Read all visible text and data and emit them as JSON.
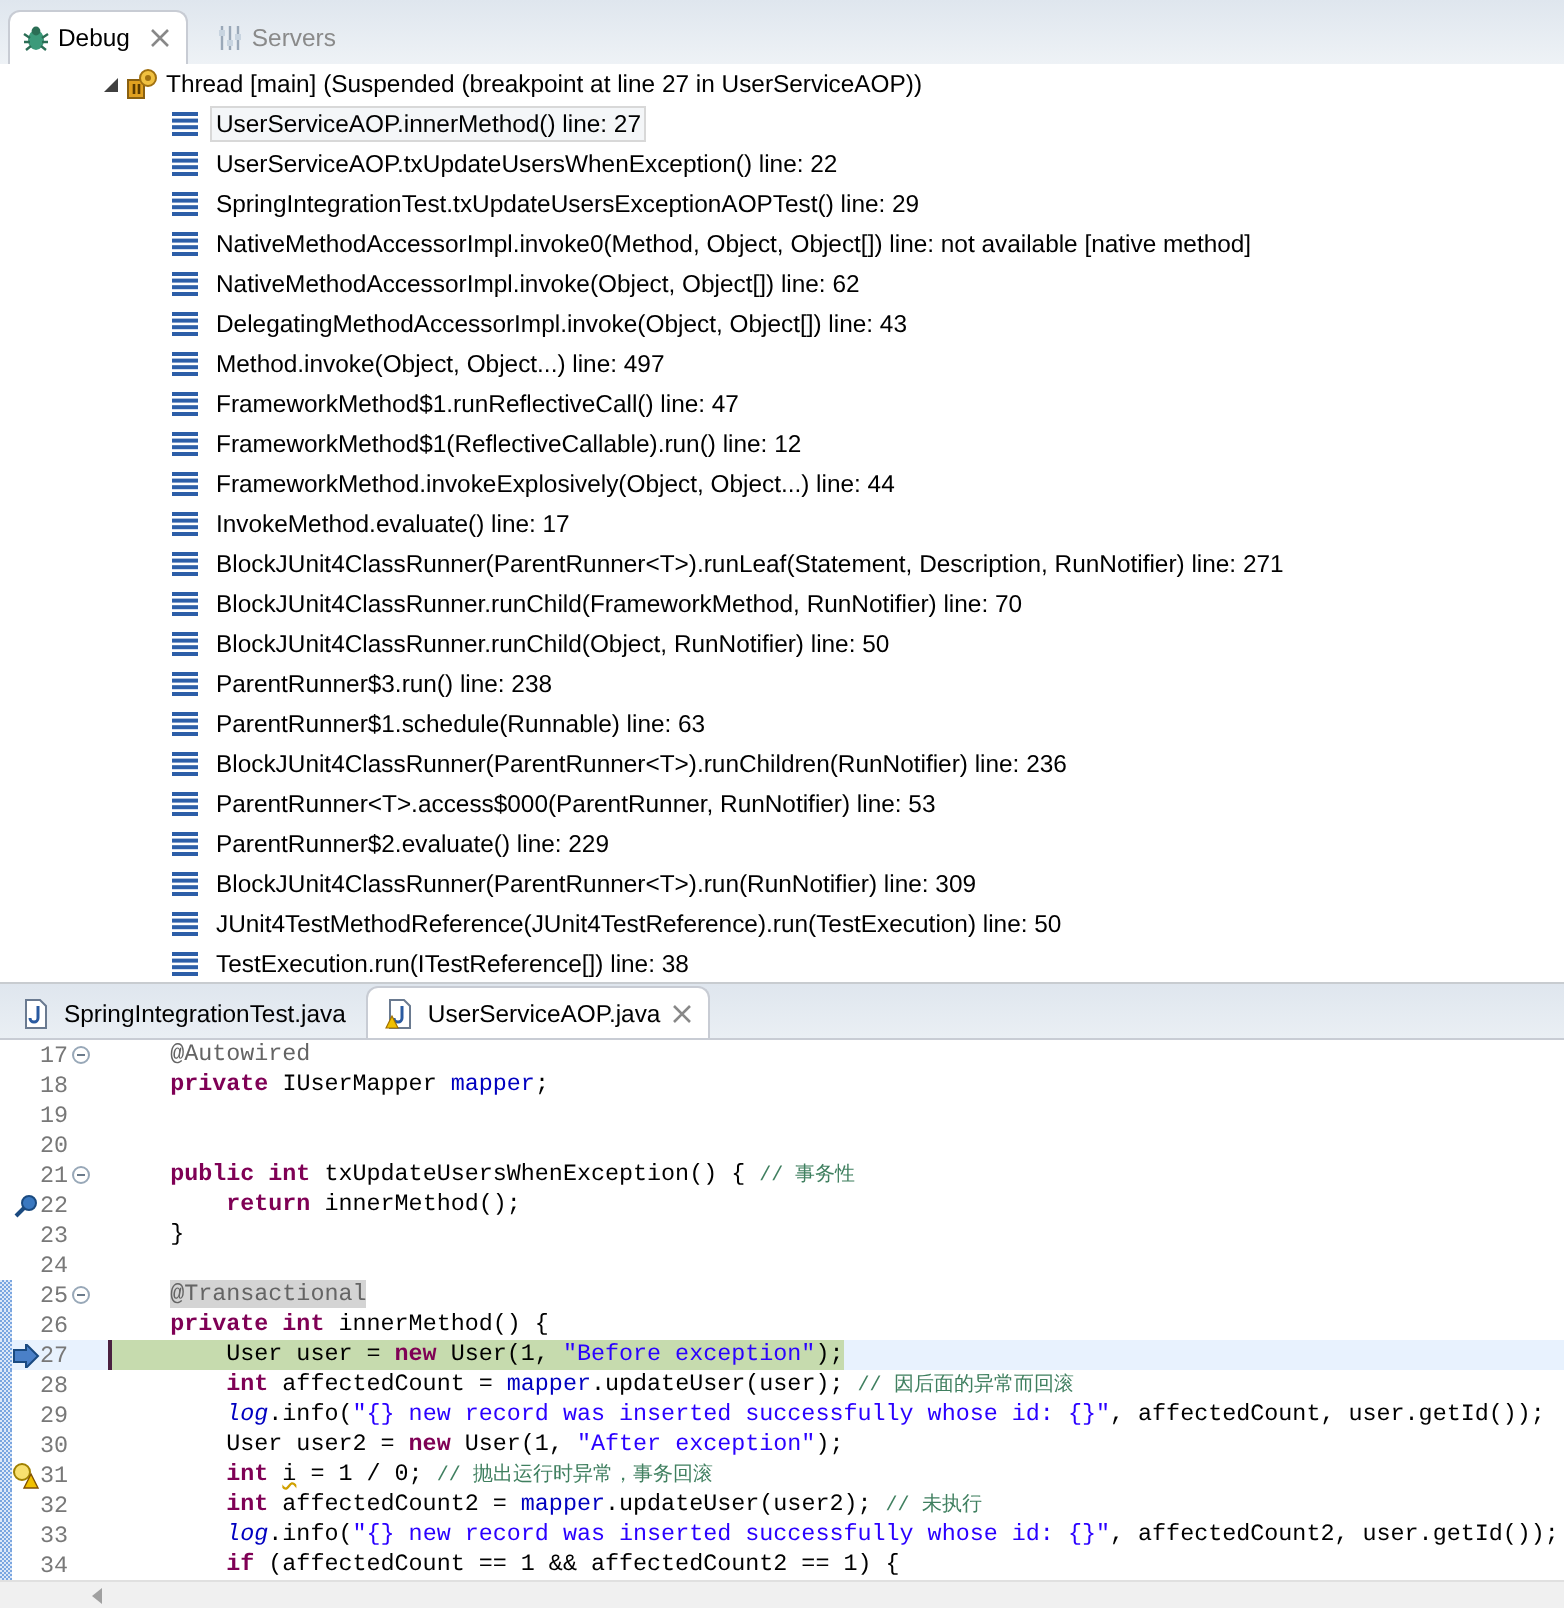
{
  "debug_view": {
    "tabs": [
      {
        "label": "Debug",
        "kind": "debug",
        "selected": true,
        "closable": true
      },
      {
        "label": "Servers",
        "kind": "servers",
        "selected": false,
        "closable": false
      }
    ],
    "thread": {
      "label": "Thread [main] (Suspended (breakpoint at line 27 in UserServiceAOP))",
      "expanded": true,
      "frames": [
        {
          "label": "UserServiceAOP.innerMethod() line: 27",
          "selected": true
        },
        {
          "label": "UserServiceAOP.txUpdateUsersWhenException() line: 22",
          "selected": false
        },
        {
          "label": "SpringIntegrationTest.txUpdateUsersExceptionAOPTest() line: 29",
          "selected": false
        },
        {
          "label": "NativeMethodAccessorImpl.invoke0(Method, Object, Object[]) line: not available [native method]",
          "selected": false
        },
        {
          "label": "NativeMethodAccessorImpl.invoke(Object, Object[]) line: 62",
          "selected": false
        },
        {
          "label": "DelegatingMethodAccessorImpl.invoke(Object, Object[]) line: 43",
          "selected": false
        },
        {
          "label": "Method.invoke(Object, Object...) line: 497",
          "selected": false
        },
        {
          "label": "FrameworkMethod$1.runReflectiveCall() line: 47",
          "selected": false
        },
        {
          "label": "FrameworkMethod$1(ReflectiveCallable).run() line: 12",
          "selected": false
        },
        {
          "label": "FrameworkMethod.invokeExplosively(Object, Object...) line: 44",
          "selected": false
        },
        {
          "label": "InvokeMethod.evaluate() line: 17",
          "selected": false
        },
        {
          "label": "BlockJUnit4ClassRunner(ParentRunner<T>).runLeaf(Statement, Description, RunNotifier) line: 271",
          "selected": false
        },
        {
          "label": "BlockJUnit4ClassRunner.runChild(FrameworkMethod, RunNotifier) line: 70",
          "selected": false
        },
        {
          "label": "BlockJUnit4ClassRunner.runChild(Object, RunNotifier) line: 50",
          "selected": false
        },
        {
          "label": "ParentRunner$3.run() line: 238",
          "selected": false
        },
        {
          "label": "ParentRunner$1.schedule(Runnable) line: 63",
          "selected": false
        },
        {
          "label": "BlockJUnit4ClassRunner(ParentRunner<T>).runChildren(RunNotifier) line: 236",
          "selected": false
        },
        {
          "label": "ParentRunner<T>.access$000(ParentRunner, RunNotifier) line: 53",
          "selected": false
        },
        {
          "label": "ParentRunner$2.evaluate() line: 229",
          "selected": false
        },
        {
          "label": "BlockJUnit4ClassRunner(ParentRunner<T>).run(RunNotifier) line: 309",
          "selected": false
        },
        {
          "label": "JUnit4TestMethodReference(JUnit4TestReference).run(TestExecution) line: 50",
          "selected": false
        },
        {
          "label": "TestExecution.run(ITestReference[]) line: 38",
          "selected": false
        }
      ]
    }
  },
  "editor": {
    "tabs": [
      {
        "label": "SpringIntegrationTest.java",
        "selected": false,
        "warning": false,
        "closable": false
      },
      {
        "label": "UserServiceAOP.java",
        "selected": true,
        "warning": true,
        "closable": true
      }
    ],
    "lines": [
      {
        "number": "17",
        "fold": true,
        "in_range": false,
        "current": false,
        "tokens": [
          {
            "text": "    @Autowired",
            "kind": "annotation"
          }
        ]
      },
      {
        "number": "18",
        "fold": false,
        "in_range": false,
        "current": false,
        "tokens": [
          {
            "text": "    private",
            "kind": "kw"
          },
          {
            "text": " IUserMapper ",
            "kind": "plain"
          },
          {
            "text": "mapper",
            "kind": "field"
          },
          {
            "text": ";",
            "kind": "plain"
          }
        ]
      },
      {
        "number": "19",
        "fold": false,
        "in_range": false,
        "current": false
      },
      {
        "number": "20",
        "fold": false,
        "in_range": false,
        "current": false
      },
      {
        "number": "21",
        "fold": true,
        "in_range": false,
        "current": false,
        "tokens": [
          {
            "text": "    public int",
            "kind": "kw"
          },
          {
            "text": " txUpdateUsersWhenException() { ",
            "kind": "plain"
          },
          {
            "text": "// 事务性",
            "kind": "comment"
          }
        ]
      },
      {
        "number": "22",
        "fold": false,
        "in_range": false,
        "current": false,
        "marker": {
          "kind": "frame"
        },
        "tokens": [
          {
            "text": "        return",
            "kind": "kw"
          },
          {
            "text": " innerMethod();",
            "kind": "plain"
          }
        ]
      },
      {
        "number": "23",
        "fold": false,
        "in_range": false,
        "current": false,
        "tokens": [
          {
            "text": "    }",
            "kind": "plain"
          }
        ]
      },
      {
        "number": "24",
        "fold": false,
        "in_range": false,
        "current": false
      },
      {
        "number": "25",
        "fold": true,
        "in_range": true,
        "current": false,
        "tokens": [
          {
            "text": "    @Transactional",
            "kind": "marked"
          }
        ]
      },
      {
        "number": "26",
        "fold": false,
        "in_range": true,
        "current": false,
        "tokens": [
          {
            "text": "    private int",
            "kind": "kw"
          },
          {
            "text": " innerMethod() {",
            "kind": "plain"
          }
        ]
      },
      {
        "number": "27",
        "fold": false,
        "in_range": true,
        "current": true,
        "marker": {
          "kind": "pointer"
        },
        "tokens": [
          {
            "text": "        User user = ",
            "kind": "plain"
          },
          {
            "text": "new",
            "kind": "kw"
          },
          {
            "text": " User(1, ",
            "kind": "plain"
          },
          {
            "text": "\"Before exception\"",
            "kind": "str"
          },
          {
            "text": ");",
            "kind": "plain"
          }
        ]
      },
      {
        "number": "28",
        "fold": false,
        "in_range": true,
        "current": false,
        "tokens": [
          {
            "text": "        int",
            "kind": "kw"
          },
          {
            "text": " affectedCount = ",
            "kind": "plain"
          },
          {
            "text": "mapper",
            "kind": "field"
          },
          {
            "text": ".updateUser(user); ",
            "kind": "plain"
          },
          {
            "text": "// 因后面的异常而回滚",
            "kind": "comment"
          }
        ]
      },
      {
        "number": "29",
        "fold": false,
        "in_range": true,
        "current": false,
        "tokens": [
          {
            "text": "        log",
            "kind": "static"
          },
          {
            "text": ".info(",
            "kind": "plain"
          },
          {
            "text": "\"{} new record was inserted successfully whose id: {}\"",
            "kind": "str"
          },
          {
            "text": ", affectedCount, user.getId());",
            "kind": "plain"
          }
        ]
      },
      {
        "number": "30",
        "fold": false,
        "in_range": true,
        "current": false,
        "tokens": [
          {
            "text": "        User user2 = ",
            "kind": "plain"
          },
          {
            "text": "new",
            "kind": "kw"
          },
          {
            "text": " User(1, ",
            "kind": "plain"
          },
          {
            "text": "\"After exception\"",
            "kind": "str"
          },
          {
            "text": ");",
            "kind": "plain"
          }
        ]
      },
      {
        "number": "31",
        "fold": false,
        "in_range": true,
        "current": false,
        "marker": {
          "kind": "warning"
        },
        "tokens": [
          {
            "text": "        int ",
            "kind": "kw"
          },
          {
            "text": "i",
            "kind": "warn"
          },
          {
            "text": " = 1 / 0; ",
            "kind": "plain"
          },
          {
            "text": "// 抛出运行时异常，事务回滚",
            "kind": "comment"
          }
        ]
      },
      {
        "number": "32",
        "fold": false,
        "in_range": true,
        "current": false,
        "tokens": [
          {
            "text": "        int",
            "kind": "kw"
          },
          {
            "text": " affectedCount2 = ",
            "kind": "plain"
          },
          {
            "text": "mapper",
            "kind": "field"
          },
          {
            "text": ".updateUser(user2); ",
            "kind": "plain"
          },
          {
            "text": "// 未执行",
            "kind": "comment"
          }
        ]
      },
      {
        "number": "33",
        "fold": false,
        "in_range": true,
        "current": false,
        "tokens": [
          {
            "text": "        log",
            "kind": "static"
          },
          {
            "text": ".info(",
            "kind": "plain"
          },
          {
            "text": "\"{} new record was inserted successfully whose id: {}\"",
            "kind": "str"
          },
          {
            "text": ", affectedCount2, user.getId());",
            "kind": "plain"
          }
        ]
      },
      {
        "number": "34",
        "fold": false,
        "in_range": true,
        "current": false,
        "tokens": [
          {
            "text": "        if",
            "kind": "kw"
          },
          {
            "text": " (affectedCount == 1 && affectedCount2 == 1) {",
            "kind": "plain"
          }
        ]
      }
    ]
  }
}
